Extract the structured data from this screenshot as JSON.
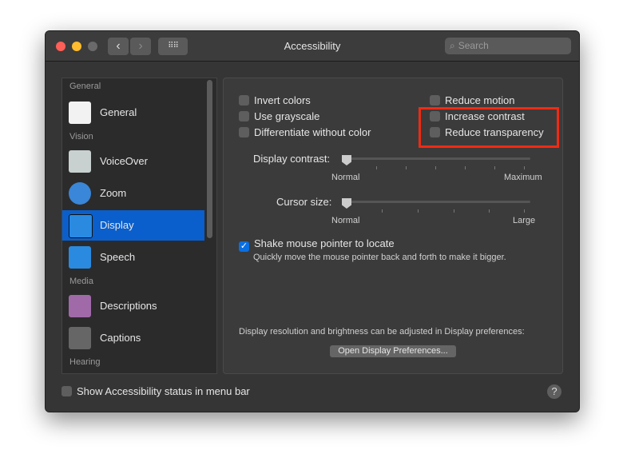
{
  "window": {
    "title": "Accessibility",
    "search_placeholder": "Search"
  },
  "sidebar": {
    "sections": [
      "General",
      "Vision",
      "Media",
      "Hearing"
    ],
    "items": [
      {
        "label": "General"
      },
      {
        "label": "VoiceOver"
      },
      {
        "label": "Zoom"
      },
      {
        "label": "Display",
        "selected": true
      },
      {
        "label": "Speech"
      },
      {
        "label": "Descriptions"
      },
      {
        "label": "Captions"
      }
    ]
  },
  "display": {
    "checkboxes": [
      {
        "label": "Invert colors",
        "checked": false
      },
      {
        "label": "Use grayscale",
        "checked": false
      },
      {
        "label": "Differentiate without color",
        "checked": false
      },
      {
        "label": "Reduce motion",
        "checked": false
      },
      {
        "label": "Increase contrast",
        "checked": false
      },
      {
        "label": "Reduce transparency",
        "checked": false
      }
    ],
    "contrast": {
      "label": "Display contrast:",
      "min": "Normal",
      "max": "Maximum",
      "value": 0
    },
    "cursor": {
      "label": "Cursor size:",
      "min": "Normal",
      "max": "Large",
      "value": 0
    },
    "shake": {
      "label": "Shake mouse pointer to locate",
      "checked": true,
      "description": "Quickly move the mouse pointer back and forth to make it bigger."
    },
    "note": "Display resolution and brightness can be adjusted in Display preferences:",
    "open_button": "Open Display Preferences..."
  },
  "footer": {
    "status_label": "Show Accessibility status in menu bar",
    "checked": false,
    "help": "?"
  },
  "colors": {
    "accent": "#0a5fcc",
    "highlight": "#f02a14"
  }
}
